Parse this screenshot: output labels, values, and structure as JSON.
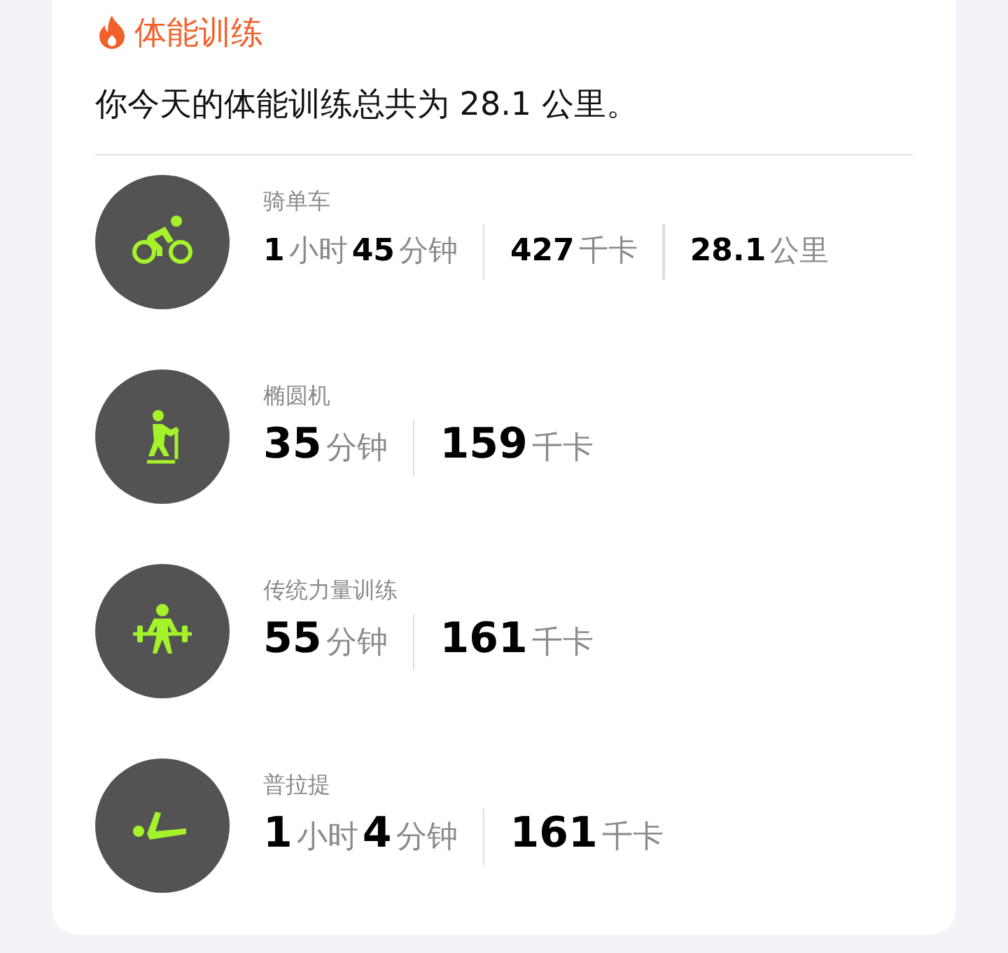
{
  "header": {
    "title": "体能训练"
  },
  "summary": "你今天的体能训练总共为 28.1 公里。",
  "workouts": [
    {
      "kind": "cycling",
      "name": "骑单车",
      "metrics": [
        "**1**小时**45**分钟",
        "**427**千卡",
        "**28.1**公里"
      ]
    },
    {
      "kind": "elliptical",
      "name": "椭圆机",
      "metrics": [
        "**35**分钟",
        "**159**千卡"
      ]
    },
    {
      "kind": "strength",
      "name": "传统力量训练",
      "metrics": [
        "**55**分钟",
        "**161**千卡"
      ]
    },
    {
      "kind": "pilates",
      "name": "普拉提",
      "metrics": [
        "**1**小时**4**分钟",
        "**161**千卡"
      ]
    }
  ]
}
